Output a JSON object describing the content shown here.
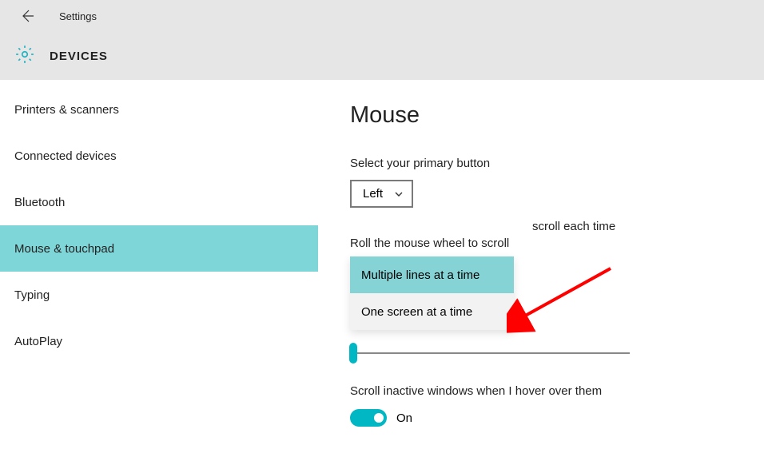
{
  "header": {
    "app_title": "Settings",
    "section": "DEVICES"
  },
  "sidebar": {
    "items": [
      {
        "label": "Printers & scanners"
      },
      {
        "label": "Connected devices"
      },
      {
        "label": "Bluetooth"
      },
      {
        "label": "Mouse & touchpad"
      },
      {
        "label": "Typing"
      },
      {
        "label": "AutoPlay"
      }
    ],
    "active_index": 3
  },
  "content": {
    "heading": "Mouse",
    "primary_button_label": "Select your primary button",
    "primary_button_value": "Left",
    "scroll_label": "Roll the mouse wheel to scroll",
    "scroll_options": [
      "Multiple lines at a time",
      "One screen at a time"
    ],
    "scroll_selected_index": 0,
    "lines_each_time_text": "scroll each time",
    "inactive_windows_label": "Scroll inactive windows when I hover over them",
    "toggle_value": "On"
  },
  "colors": {
    "accent": "#00b7c3",
    "accent_light": "#86d3d5"
  }
}
